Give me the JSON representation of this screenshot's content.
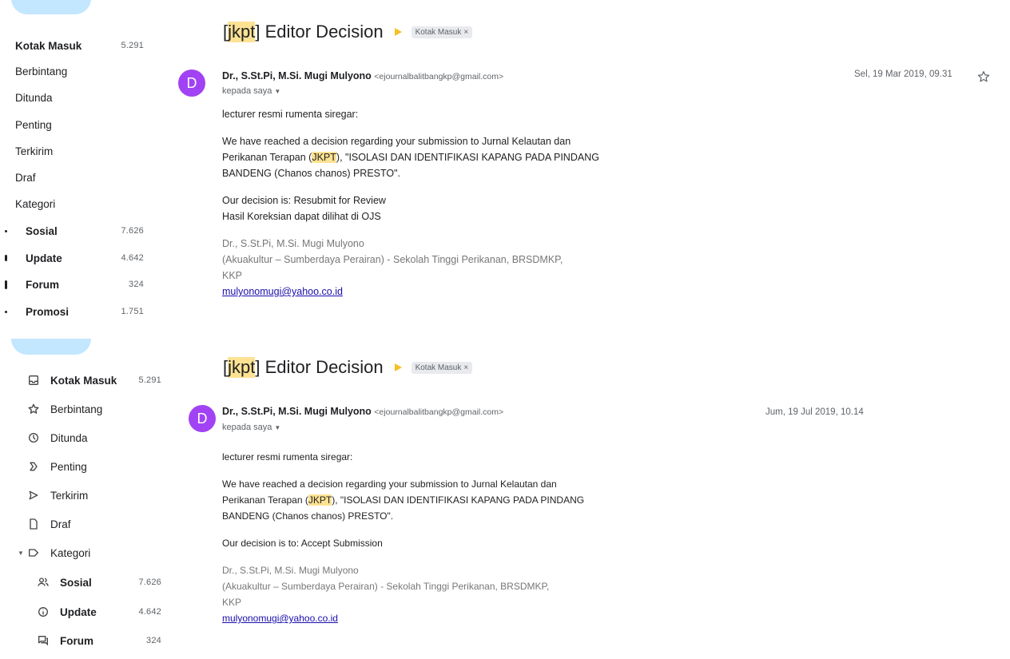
{
  "panels": [
    {
      "sidebar": {
        "items": [
          {
            "label": "Kotak Masuk",
            "count": "5.291"
          },
          {
            "label": "Berbintang",
            "count": ""
          },
          {
            "label": "Ditunda",
            "count": ""
          },
          {
            "label": "Penting",
            "count": ""
          },
          {
            "label": "Terkirim",
            "count": ""
          },
          {
            "label": "Draf",
            "count": ""
          },
          {
            "label": "Kategori",
            "count": ""
          },
          {
            "label": "Sosial",
            "count": "7.626"
          },
          {
            "label": "Update",
            "count": "4.642"
          },
          {
            "label": "Forum",
            "count": "324"
          },
          {
            "label": "Promosi",
            "count": "1.751"
          }
        ]
      },
      "email": {
        "subject_prefix": "[",
        "subject_tag": "jkpt",
        "subject_rest": "] Editor Decision",
        "label_chip": "Kotak Masuk",
        "avatar_letter": "D",
        "sender_name": "Dr., S.St.Pi, M.Si. Mugi Mulyono",
        "sender_email": "<ejournalbalitbangkp@gmail.com>",
        "to": "kepada saya",
        "date": "Sel, 19 Mar 2019, 09.31",
        "greeting": "lecturer resmi rumenta siregar:",
        "para1_a": "We have reached a decision regarding your submission to Jurnal Kelautan dan",
        "para1_b": "Perikanan Terapan (",
        "para1_hl": "JKPT",
        "para1_c": "), \"ISOLASI DAN IDENTIFIKASI KAPANG PADA PINDANG",
        "para1_d": "BANDENG (Chanos chanos) PRESTO\".",
        "decision": "Our decision is: Resubmit for Review",
        "note": "Hasil Koreksian dapat dilihat di OJS",
        "sig1": "Dr., S.St.Pi, M.Si. Mugi Mulyono",
        "sig2": "(Akuakultur – Sumberdaya Perairan)  - Sekolah Tinggi Perikanan, BRSDMKP,",
        "sig3": "KKP",
        "sig_email": "mulyonomugi@yahoo.co.id"
      }
    },
    {
      "sidebar": {
        "items": [
          {
            "label": "Kotak Masuk",
            "count": "5.291",
            "icon": "inbox-icon"
          },
          {
            "label": "Berbintang",
            "count": "",
            "icon": "star-icon"
          },
          {
            "label": "Ditunda",
            "count": "",
            "icon": "clock-icon"
          },
          {
            "label": "Penting",
            "count": "",
            "icon": "important-icon"
          },
          {
            "label": "Terkirim",
            "count": "",
            "icon": "send-icon"
          },
          {
            "label": "Draf",
            "count": "",
            "icon": "draft-icon"
          },
          {
            "label": "Kategori",
            "count": "",
            "icon": "label-icon"
          },
          {
            "label": "Sosial",
            "count": "7.626",
            "icon": "people-icon"
          },
          {
            "label": "Update",
            "count": "4.642",
            "icon": "info-icon"
          },
          {
            "label": "Forum",
            "count": "324",
            "icon": "forum-icon"
          }
        ]
      },
      "email": {
        "subject_prefix": "[",
        "subject_tag": "jkpt",
        "subject_rest": "] Editor Decision",
        "label_chip": "Kotak Masuk",
        "avatar_letter": "D",
        "sender_name": "Dr., S.St.Pi, M.Si. Mugi Mulyono",
        "sender_email": "<ejournalbalitbangkp@gmail.com>",
        "to": "kepada saya",
        "date": "Jum, 19 Jul 2019, 10.14",
        "greeting": "lecturer resmi rumenta siregar:",
        "para1_a": "We have reached a decision regarding your submission to Jurnal Kelautan dan",
        "para1_b": "Perikanan Terapan (",
        "para1_hl": "JKPT",
        "para1_c": "), \"ISOLASI DAN IDENTIFIKASI KAPANG PADA PINDANG",
        "para1_d": "BANDENG (Chanos chanos) PRESTO\".",
        "decision": "Our decision is to: Accept Submission",
        "sig1": "Dr., S.St.Pi, M.Si. Mugi Mulyono",
        "sig2": "(Akuakultur – Sumberdaya Perairan)  - Sekolah Tinggi Perikanan, BRSDMKP,",
        "sig3": "KKP",
        "sig_email": "mulyonomugi@yahoo.co.id"
      }
    }
  ]
}
